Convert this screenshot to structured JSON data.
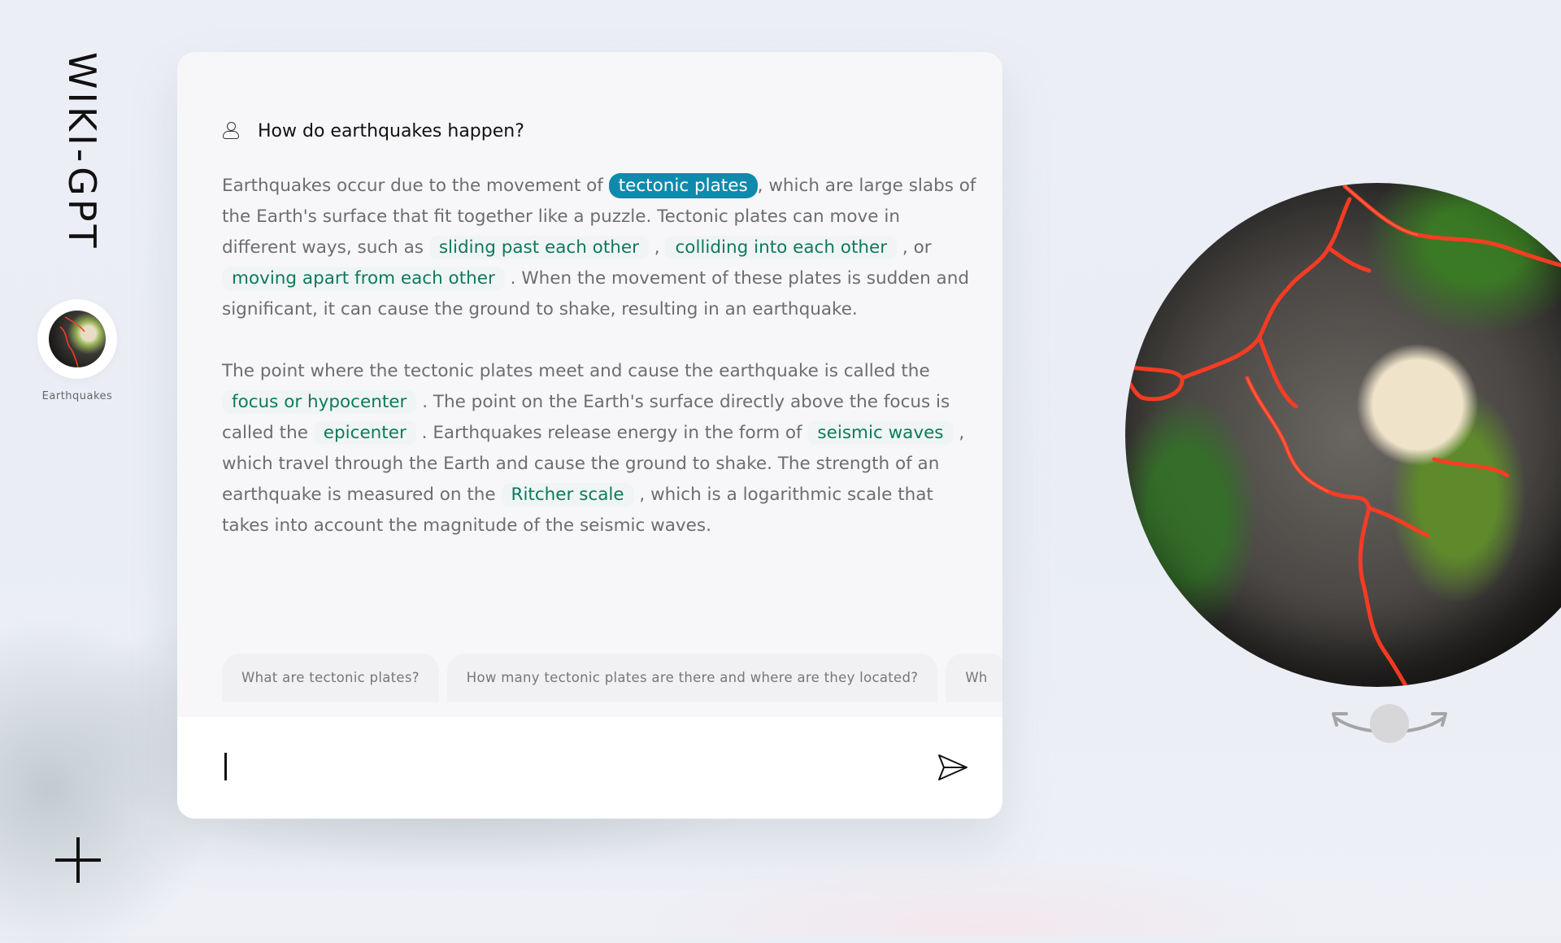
{
  "brand": "WIKI-GPT",
  "topics": [
    {
      "label": "Earthquakes"
    }
  ],
  "chat": {
    "question": "How do earthquakes happen?",
    "answer": {
      "p1": {
        "t0": "Earthquakes occur due to the movement of ",
        "k0": "tectonic plates",
        "t1": ", which are large slabs of the Earth's surface that fit together like a puzzle. Tectonic plates can move in different ways, such as ",
        "k1": "sliding past each other",
        "t2": " , ",
        "k2": "colliding into each other",
        "t3": " , or ",
        "k3": "moving apart from each other",
        "t4": " . When the movement of these plates is sudden and significant, it can cause the ground to shake, resulting in an earthquake."
      },
      "p2": {
        "t0": "The point where the tectonic plates meet and cause the earthquake is called the ",
        "k0": "focus or hypocenter",
        "t1": " . The point on the Earth's surface directly above the focus is called the ",
        "k1": "epicenter",
        "t2": " . Earthquakes release energy in the form of ",
        "k2": "seismic waves",
        "t3": " , which travel through the Earth and cause the ground to shake. The strength of an earthquake is measured on the ",
        "k3": "Ritcher scale",
        "t4": " , which is a logarithmic scale that takes into account the magnitude of the seismic waves."
      }
    },
    "suggestions": [
      "What are tectonic plates?",
      "How many tectonic plates are there and where are they located?",
      "Wh"
    ],
    "input": {
      "value": ""
    }
  },
  "icons": {
    "user": "user-icon",
    "send": "paper-plane-icon",
    "add": "plus-icon",
    "rotate": "rotate-arrows-icon"
  },
  "colors": {
    "primary_highlight": "#0f8aad",
    "keyword_text": "#0d7a5c",
    "fault_lines": "#ff3b22"
  }
}
